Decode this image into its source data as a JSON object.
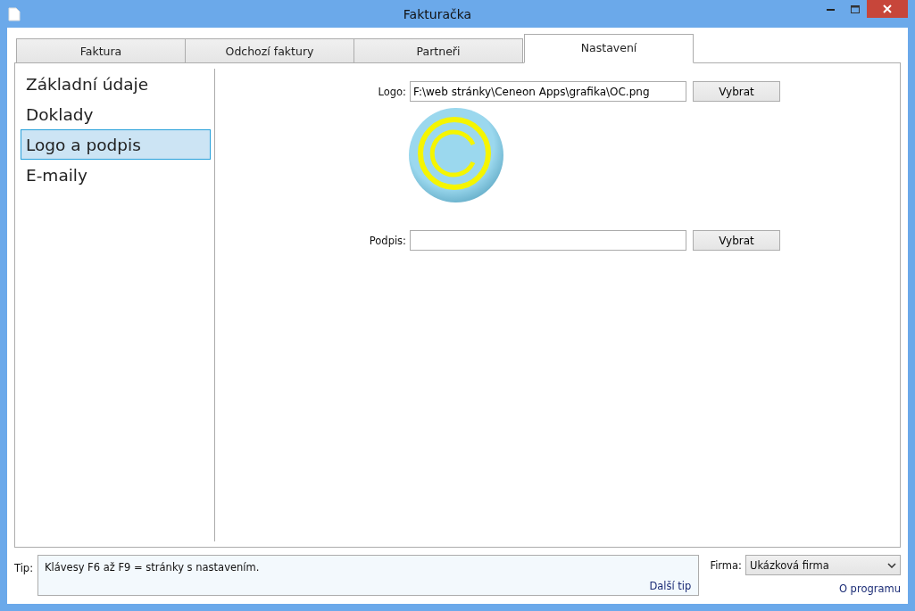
{
  "window": {
    "title": "Fakturačka"
  },
  "tabs": [
    {
      "label": "Faktura",
      "selected": false
    },
    {
      "label": "Odchozí faktury",
      "selected": false
    },
    {
      "label": "Partneři",
      "selected": false
    },
    {
      "label": "Nastavení",
      "selected": true
    }
  ],
  "sidebar": {
    "items": [
      {
        "label": "Základní údaje",
        "selected": false
      },
      {
        "label": "Doklady",
        "selected": false
      },
      {
        "label": "Logo a podpis",
        "selected": true
      },
      {
        "label": "E-maily",
        "selected": false
      }
    ]
  },
  "form": {
    "fields": [
      {
        "label": "Logo:",
        "value": "F:\\web stránky\\Ceneon Apps\\grafika\\OC.png",
        "button": "Vybrat"
      },
      {
        "label": "Podpis:",
        "button": "Vybrat"
      }
    ]
  },
  "tip": {
    "label": "Tip:",
    "text": "Klávesy F6 až F9 = stránky s nastavením.",
    "next_link": "Další tip"
  },
  "company": {
    "label": "Firma:",
    "value": "Ukázková firma"
  },
  "about_link": "O programu"
}
